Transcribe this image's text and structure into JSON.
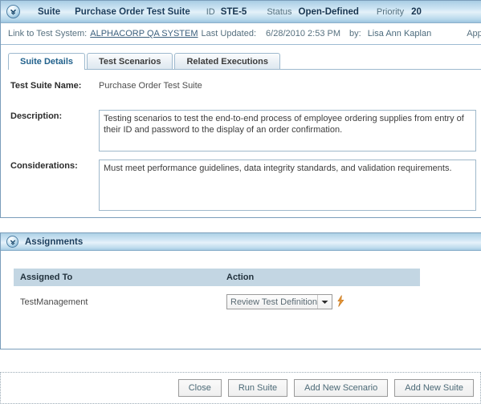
{
  "suite": {
    "header": {
      "collapse_icon": "chevron-down-circle-icon",
      "entity_label": "Suite",
      "title": "Purchase Order Test Suite",
      "id_label": "ID",
      "id_value": "STE-5",
      "status_label": "Status",
      "status_value": "Open-Defined",
      "priority_label": "Priority",
      "priority_value": "20"
    },
    "subheader": {
      "link_label": "Link to Test System:",
      "link_text": "ALPHACORP QA SYSTEM",
      "updated_label": "Last Updated:",
      "updated_value": "6/28/2010 2:53 PM",
      "by_label": "by:",
      "by_value": "Lisa Ann Kaplan",
      "application_label": "Application:"
    },
    "tabs": [
      {
        "label": "Suite Details",
        "active": true
      },
      {
        "label": "Test Scenarios",
        "active": false
      },
      {
        "label": "Related Executions",
        "active": false
      }
    ],
    "details": {
      "name_label": "Test Suite Name:",
      "name_value": "Purchase Order Test Suite",
      "description_label": "Description:",
      "description_value": "Testing scenarios to test the end-to-end process of employee ordering supplies from entry of their ID and password to the display of an order confirmation.",
      "considerations_label": "Considerations:",
      "considerations_value": "Must meet performance guidelines, data integrity standards, and validation requirements."
    }
  },
  "assignments": {
    "collapse_icon": "chevron-down-circle-icon",
    "title": "Assignments",
    "columns": [
      "Assigned To",
      "Action"
    ],
    "rows": [
      {
        "assigned_to": "TestManagement",
        "action_selected": "Review Test Definition",
        "action_icon": "flash-action-icon"
      }
    ]
  },
  "buttonbar": {
    "buttons": [
      {
        "label": "Close"
      },
      {
        "label": "Run Suite"
      },
      {
        "label": "Add New Scenario"
      },
      {
        "label": "Add New Suite"
      }
    ]
  },
  "colors": {
    "panel_border": "#7a9dba",
    "header_blue": "#cfe6f4",
    "active_tab_text": "#21618c",
    "table_header": "#c3d6e3",
    "accent_orange": "#e08a2e"
  }
}
